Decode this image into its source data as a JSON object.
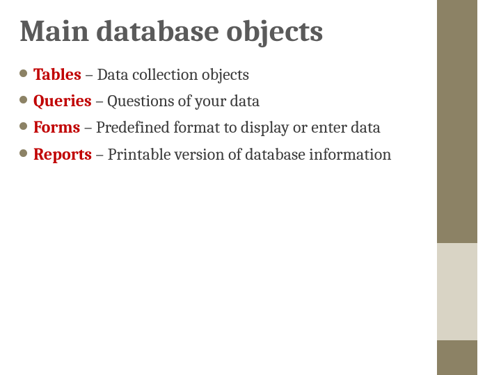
{
  "title": "Main database objects",
  "items": [
    {
      "term": "Tables",
      "desc": " – Data collection objects"
    },
    {
      "term": "Queries",
      "desc": " – Questions of your data"
    },
    {
      "term": "Forms",
      "desc": " – Predefined format to display or enter data"
    },
    {
      "term": "Reports",
      "desc": " – Printable version of database information"
    }
  ]
}
